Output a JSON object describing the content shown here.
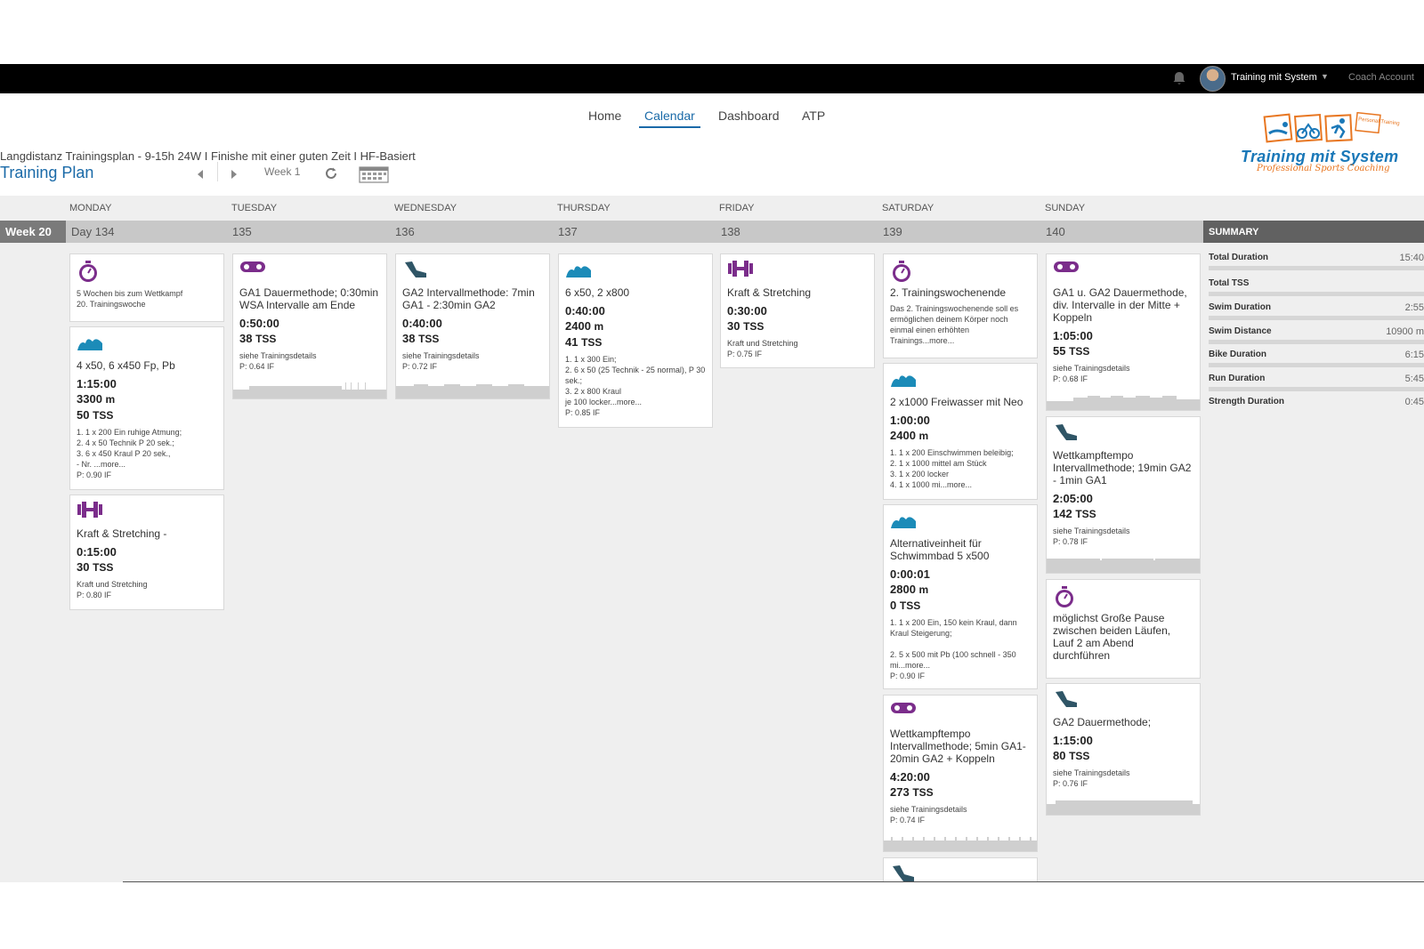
{
  "topbar": {
    "user_name": "Training mit System",
    "caret": "▼",
    "coach_account": "Coach Account"
  },
  "nav": {
    "items": [
      "Home",
      "Calendar",
      "Dashboard",
      "ATP"
    ],
    "active": "Calendar"
  },
  "plan": {
    "subtitle": "Langdistanz Trainingsplan - 9-15h 24W I Finishe mit einer guten Zeit I HF-Basiert",
    "title": "Training Plan",
    "week_label": "Week 1"
  },
  "logo": {
    "brand": "Training mit System",
    "tagline": "Professional Sports Coaching",
    "badge": "Personal Training"
  },
  "calendar": {
    "days": [
      "MONDAY",
      "TUESDAY",
      "WEDNESDAY",
      "THURSDAY",
      "FRIDAY",
      "SATURDAY",
      "SUNDAY"
    ],
    "day_numbers": [
      "Day 134",
      "135",
      "136",
      "137",
      "138",
      "139",
      "140"
    ],
    "week": "Week 20"
  },
  "summary": {
    "title": "SUMMARY",
    "rows": [
      {
        "label": "Total Duration",
        "value": "15:40"
      },
      {
        "label": "Total TSS",
        "value": ""
      },
      {
        "label": "Swim Duration",
        "value": "2:55"
      },
      {
        "label": "Swim Distance",
        "value": "10900 m"
      },
      {
        "label": "Bike Duration",
        "value": "6:15"
      },
      {
        "label": "Run Duration",
        "value": "5:45"
      },
      {
        "label": "Strength Duration",
        "value": "0:45"
      }
    ]
  },
  "workouts": {
    "mon": [
      {
        "icon": "stopwatch-icon",
        "title": "",
        "note": "5 Wochen bis zum Wettkampf\n20. Trainingswoche"
      },
      {
        "icon": "swim-icon",
        "title": "4 x50, 6 x450 Fp, Pb",
        "duration": "1:15:00",
        "distance": "3300",
        "dist_unit": "m",
        "tss": "50",
        "tss_unit": "TSS",
        "note": "1. 1 x 200 Ein ruhige Atmung;\n2. 4 x 50 Technik P 20 sek.;\n3. 6 x 450 Kraul P 20 sek.,\n- Nr. ...more...",
        "pif": "P: 0.90 IF"
      },
      {
        "icon": "strength-icon",
        "title": "Kraft & Stretching -",
        "duration": "0:15:00",
        "tss": "30",
        "tss_unit": "TSS",
        "note": "Kraft und Stretching",
        "pif": "P: 0.80 IF"
      }
    ],
    "tue": [
      {
        "icon": "bike-icon",
        "title": "GA1 Dauermethode; 0:30min WSA Intervalle am Ende",
        "duration": "0:50:00",
        "tss": "38",
        "tss_unit": "TSS",
        "note": "siehe Trainingsdetails",
        "pif": "P: 0.64 IF"
      }
    ],
    "wed": [
      {
        "icon": "run-icon",
        "title": "GA2 Intervallmethode: 7min GA1 - 2:30min GA2",
        "duration": "0:40:00",
        "tss": "38",
        "tss_unit": "TSS",
        "note": "siehe Trainingsdetails",
        "pif": "P: 0.72 IF"
      }
    ],
    "thu": [
      {
        "icon": "swim-icon",
        "title": "6 x50, 2 x800",
        "duration": "0:40:00",
        "distance": "2400",
        "dist_unit": "m",
        "tss": "41",
        "tss_unit": "TSS",
        "note": "1. 1 x 300 Ein;\n2. 6 x 50 (25 Technik - 25 normal), P 30 sek.;\n3. 2 x 800 Kraul\nje 100 locker...more...",
        "pif": "P: 0.85 IF"
      }
    ],
    "fri": [
      {
        "icon": "strength-icon",
        "title": "Kraft & Stretching",
        "duration": "0:30:00",
        "tss": "30",
        "tss_unit": "TSS",
        "note": "Kraft und Stretching",
        "pif": "P: 0.75 IF"
      }
    ],
    "sat": [
      {
        "icon": "stopwatch-icon",
        "title": "2. Trainingswochenende",
        "note": "Das 2. Trainingswochenende soll es ermöglichen deinem Körper noch einmal einen erhöhten Trainings...more..."
      },
      {
        "icon": "swim-icon",
        "title": "2 x1000 Freiwasser mit Neo",
        "duration": "1:00:00",
        "distance": "2400",
        "dist_unit": "m",
        "note": "1. 1 x 200 Einschwimmen beleibig;\n2. 1 x 1000 mittel am Stück\n3. 1 x 200 locker\n4. 1 x 1000 mi...more..."
      },
      {
        "icon": "swim-icon",
        "title": "Alternativeinheit für Schwimmbad 5 x500",
        "duration": "0:00:01",
        "distance": "2800",
        "dist_unit": "m",
        "tss": "0",
        "tss_unit": "TSS",
        "note": "1. 1 x 200 Ein, 150 kein Kraul, dann Kraul Steigerung;\n\n2. 5 x 500 mit Pb (100 schnell - 350 mi...more...",
        "pif": "P: 0.90 IF"
      },
      {
        "icon": "bike-icon",
        "title": "Wettkampftempo Intervallmethode; 5min GA1-20min GA2 + Koppeln",
        "duration": "4:20:00",
        "tss": "273",
        "tss_unit": "TSS",
        "note": "siehe Trainingsdetails",
        "pif": "P: 0.74 IF"
      },
      {
        "icon": "run-icon",
        "title": ""
      }
    ],
    "sun": [
      {
        "icon": "bike-icon",
        "title": "GA1 u. GA2 Dauermethode, div. Intervalle in der Mitte + Koppeln",
        "duration": "1:05:00",
        "tss": "55",
        "tss_unit": "TSS",
        "note": "siehe Trainingsdetails",
        "pif": "P: 0.68 IF"
      },
      {
        "icon": "run-icon",
        "title": "Wettkampftempo Intervallmethode; 19min GA2 - 1min GA1",
        "duration": "2:05:00",
        "tss": "142",
        "tss_unit": "TSS",
        "note": "siehe Trainingsdetails",
        "pif": "P: 0.78 IF"
      },
      {
        "icon": "stopwatch-icon",
        "title": "möglichst Große Pause zwischen beiden Läufen, Lauf 2 am Abend durchführen"
      },
      {
        "icon": "run-icon",
        "title": "GA2 Dauermethode;",
        "duration": "1:15:00",
        "tss": "80",
        "tss_unit": "TSS",
        "note": "siehe Trainingsdetails",
        "pif": "P: 0.76 IF"
      }
    ]
  },
  "colors": {
    "accent": "#1a6aa8",
    "purple": "#7b2d8b",
    "swim": "#1b8bb8",
    "run": "#2f5566"
  }
}
